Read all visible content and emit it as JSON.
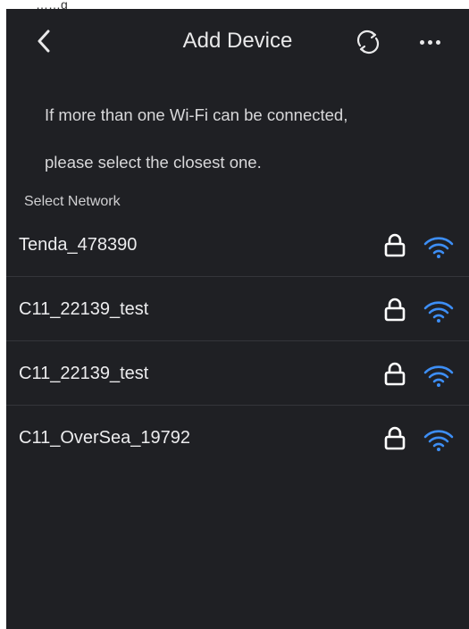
{
  "top_clip_text": "……g",
  "header": {
    "back_icon": "chevron-left-icon",
    "title": "Add Device",
    "refresh_icon": "refresh-icon",
    "more_icon": "more-dots-icon"
  },
  "tip": {
    "line1": "If more than one Wi-Fi can be connected,",
    "line2": "please select the closest one."
  },
  "section_label": "Select Network",
  "colors": {
    "background": "#1f2024",
    "wifi_signal": "#3d8ef5",
    "text": "#ececee"
  },
  "networks": [
    {
      "ssid": "Tenda_478390",
      "lock_icon": "lock-icon",
      "signal_icon": "wifi-icon"
    },
    {
      "ssid": "C11_22139_test",
      "lock_icon": "lock-icon",
      "signal_icon": "wifi-icon"
    },
    {
      "ssid": "C11_22139_test",
      "lock_icon": "lock-icon",
      "signal_icon": "wifi-icon"
    },
    {
      "ssid": "C11_OverSea_19792",
      "lock_icon": "lock-icon",
      "signal_icon": "wifi-icon"
    }
  ]
}
